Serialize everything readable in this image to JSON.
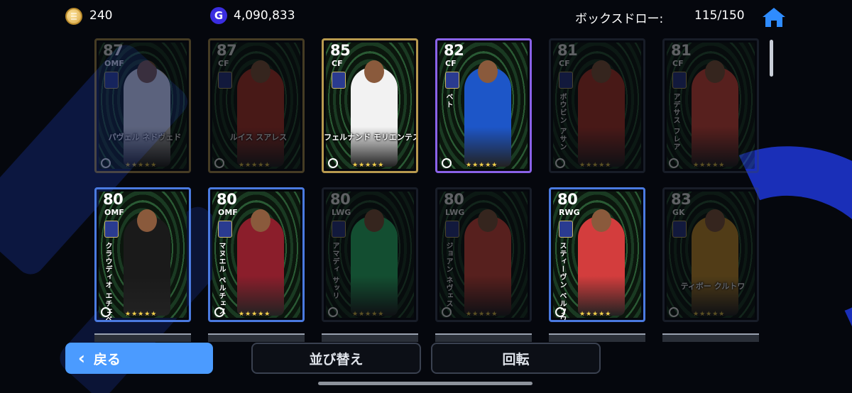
{
  "header": {
    "coins": "240",
    "gp": "4,090,833",
    "gp_icon_letter": "G",
    "box_draw_label": "ボックスドロー:",
    "box_draw_count": "115/150"
  },
  "cards": [
    {
      "rating": "87",
      "position": "OMF",
      "name": "パヴェル ネドヴェド",
      "name_style": "horiz",
      "border": "gold",
      "dim": true,
      "kit": "#e8e8e8"
    },
    {
      "rating": "87",
      "position": "CF",
      "name": "ルイス スアレス",
      "name_style": "horiz",
      "border": "gold",
      "dim": true,
      "kit": "#c0392b"
    },
    {
      "rating": "85",
      "position": "CF",
      "name": "フェルナンド モリエンテス",
      "name_style": "horiz",
      "border": "gold",
      "dim": false,
      "kit": "#f2f2f2"
    },
    {
      "rating": "82",
      "position": "CF",
      "name": "ベト",
      "name_style": "vertical",
      "border": "purple",
      "dim": false,
      "kit": "#1d56c8"
    },
    {
      "rating": "81",
      "position": "CF",
      "name": "ボウビン アサン",
      "name_style": "vertical",
      "border": "dark",
      "dim": true,
      "kit": "#c0392b"
    },
    {
      "rating": "81",
      "position": "CF",
      "name": "アデサス フレア",
      "name_style": "vertical",
      "border": "dark",
      "dim": true,
      "kit": "#e74c3c"
    },
    {
      "rating": "80",
      "position": "OMF",
      "name": "クラウディオ エチェベリ",
      "name_style": "vertical",
      "border": "blue",
      "dim": false,
      "kit": "#1a1a1a"
    },
    {
      "rating": "80",
      "position": "OMF",
      "name": "マヌエル ペルチェス",
      "name_style": "vertical",
      "border": "blue",
      "dim": false,
      "kit": "#8b1e2b"
    },
    {
      "rating": "80",
      "position": "LWG",
      "name": "アマディ サッリ",
      "name_style": "vertical",
      "border": "dark",
      "dim": true,
      "kit": "#2ecc71"
    },
    {
      "rating": "80",
      "position": "LWG",
      "name": "ジョアン ネヴェス",
      "name_style": "vertical",
      "border": "dark",
      "dim": true,
      "kit": "#e74c3c"
    },
    {
      "rating": "80",
      "position": "RWG",
      "name": "スティーヴン ベルフワイス",
      "name_style": "vertical",
      "border": "blue",
      "dim": false,
      "kit": "#d33d3d"
    },
    {
      "rating": "83",
      "position": "GK",
      "name": "ティボー クルトワ",
      "name_style": "horiz",
      "border": "dark",
      "dim": true,
      "kit": "#d79b2b"
    }
  ],
  "stars": "★★★★★",
  "buttons": {
    "back": "戻る",
    "sort": "並び替え",
    "rotate": "回転"
  },
  "colors": {
    "accent_blue": "#4b9bff",
    "gold_border": "#b89a4e",
    "blue_border": "#4a7ae0",
    "purple_border": "#8a62e8",
    "dark_border": "#3a4658"
  }
}
